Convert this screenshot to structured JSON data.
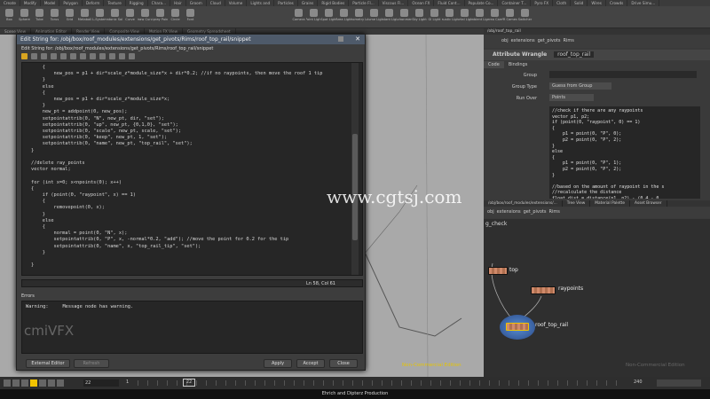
{
  "shelf": {
    "tabs": [
      "Create",
      "Modify",
      "Model",
      "Polygon",
      "Deform",
      "Texture",
      "Rigging",
      "Chara...",
      "Hair",
      "Groom",
      "Cloud",
      "Volume",
      "Lights and",
      "Particles",
      "Grains",
      "Rigid Bodies",
      "Particle Fl...",
      "Viscous Fl...",
      "Ocean FX",
      "Fluid Cont...",
      "Populate Co...",
      "Container T...",
      "Pyro FX",
      "Cloth",
      "Solid",
      "Wires",
      "Crowds",
      "Drive Simu..."
    ],
    "tools": [
      "Box",
      "Sphere",
      "Tube",
      "Torus",
      "Grid",
      "Metaball",
      "L-System",
      "Platonic Sol...",
      "Curve",
      "Draw Curve",
      "Spray Paint",
      "Circle",
      "Font"
    ],
    "light_tools": [
      "Camera",
      "Point Light",
      "Spot Light",
      "Area Light",
      "Geometry L...",
      "Volume Light",
      "Distant Light",
      "Environmen...",
      "Sky Light",
      "GI Light",
      "Caustic Light",
      "Portal Light",
      "Ambient Lig...",
      "Stereo Cam...",
      "VR Camera",
      "Switcher"
    ]
  },
  "panels": {
    "left": [
      "Scene View",
      "Animation Editor",
      "Render View",
      "Composite View",
      "Motion FX View",
      "Geometry Spreadsheet"
    ]
  },
  "dialog": {
    "title": "Edit String for: /obj/box/roof_modules/extensions/get_pivots/Rims/roof_top_rail/snippet",
    "path": "Edit String for: /obj/box/roof_modules/extensions/get_pivots/Rims/roof_top_rail/snippet",
    "code": "    {\n        new_pos = p1 + dir*scale_z*module_size*x + dir*0.2; //if no raypoints, then move the roof 1 tip\n    }\n    else\n    {\n        new_pos = p1 + dir*scale_z*module_size*x;\n    }\n    new_pt = addpoint(0, new_pos);\n    setpointattrib(0, \"N\", new_pt, dir, \"set\");\n    setpointattrib(0, \"up\", new_pt, {0,1,0}, \"set\");\n    setpointattrib(0, \"scale\", new_pt, scale, \"set\");\n    setpointattrib(0, \"keep\", new_pt, 1, \"set\");\n    setpointattrib(0, \"name\", new_pt, \"top_rail\", \"set\");\n}\n\n//delete ray_points\nvector normal;\n\nfor (int x=0; x<npoints(0); x++)\n{\n    if (point(0, \"raypoint\", x) == 1)\n    {\n        removepoint(0, x);\n    }\n    else\n    {\n        normal = point(0, \"N\", x);\n        setpointattrib(0, \"P\", x, -normal*0.2, \"add\"); //move the point for 0.2 for the tip\n        setpointattrib(0, \"name\", x, \"top_rail_tip\", \"set\");\n    }\n\n}",
    "position": "Ln 58, Col 61",
    "errors_label": "Errors",
    "error_text": "Warning:     Message node has warning.",
    "buttons": {
      "external": "External Editor",
      "refresh": "Refresh",
      "apply": "Apply",
      "accept": "Accept",
      "close": "Close"
    }
  },
  "right": {
    "top_tab": "/obj/roof_top_rail",
    "path": [
      "obj",
      "extensions",
      "get_pivots",
      "Rims"
    ],
    "node_type": "Attribute Wrangle",
    "node_name": "roof_top_rail",
    "subtabs": [
      "Code",
      "Bindings"
    ],
    "params": [
      {
        "label": "Group",
        "value": ""
      },
      {
        "label": "Group Type",
        "value": "Guess from Group"
      },
      {
        "label": "Run Over",
        "value": "Points"
      }
    ],
    "snippet": "//check if there are any raypoints\nvector p1, p2;\nif (point(0, \"raypoint\", 0) == 1)\n{\n    p1 = point(0, \"P\", 0);\n    p2 = point(0, \"P\", 2);\n}\nelse\n{\n    p1 = point(0, \"P\", 1);\n    p2 = point(0, \"P\", 2);\n}\n\n//based on the amount of raypoint in the s\n//recalculate the distance\nfloat dist = distance(p1, p2) - (0.4 - 0.",
    "net_tabs": [
      "/obj/box/roof_modules/extensions/...",
      "Tree View",
      "Material Palette",
      "Asset Browser"
    ],
    "net_path": [
      "obj",
      "extensions",
      "get_pivots",
      "Rims"
    ],
    "net_label": "g_check",
    "nodes": {
      "top": "top",
      "raypoints": "raypoints",
      "rail": "roof_top_rail"
    },
    "watermark": "Non-Commercial Edition"
  },
  "viewport_watermark": "Non-Commercial Edition",
  "timeline": {
    "frame": "22",
    "start": "1",
    "marker": "22",
    "end": "240"
  },
  "status": "Ehrich and Dipterz Production",
  "overlay": {
    "site": "www.cgtsj.com",
    "brand": "cmiVFX"
  },
  "colors": {
    "accent": "#f2c300",
    "keyword": "#6fa8ff",
    "string": "#9ad36a",
    "comment": "#bfbfbf"
  }
}
